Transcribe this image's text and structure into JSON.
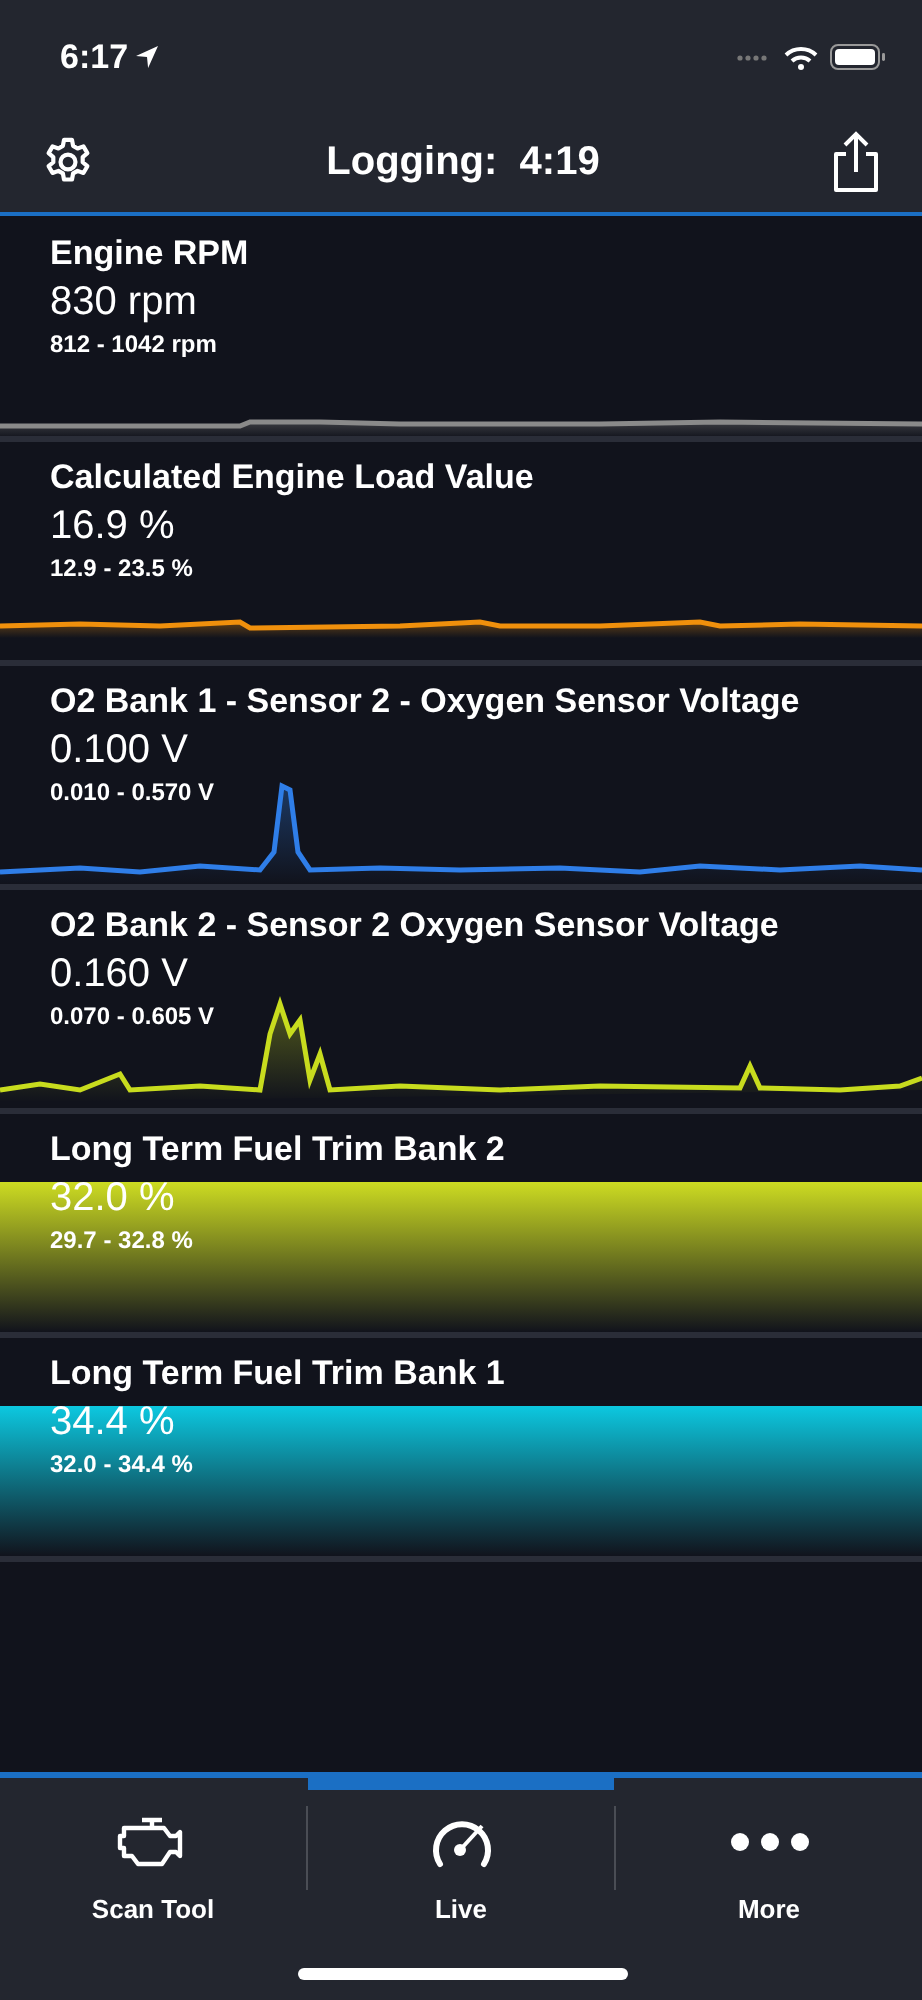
{
  "status_bar": {
    "time": "6:17"
  },
  "header": {
    "title": "Logging:  4:19"
  },
  "gauges": [
    {
      "kind": "line",
      "name": "Engine RPM",
      "value": "830 rpm",
      "range": "812 - 1042 rpm",
      "color": "#8a8a8a"
    },
    {
      "kind": "line",
      "name": "Calculated Engine Load Value",
      "value": "16.9 %",
      "range": "12.9 - 23.5 %",
      "color": "#f0900c"
    },
    {
      "kind": "line",
      "name": "O2 Bank 1 - Sensor 2 - Oxygen Sensor Voltage",
      "value": "0.100 V",
      "range": "0.010 - 0.570 V",
      "color": "#2f7ee8"
    },
    {
      "kind": "line",
      "name": "O2 Bank 2 - Sensor 2 Oxygen Sensor Voltage",
      "value": "0.160 V",
      "range": "0.070 - 0.605 V",
      "color": "#c8dc1e"
    },
    {
      "kind": "fill",
      "name": "Long Term Fuel Trim Bank 2",
      "value": "32.0 %",
      "range": "29.7 - 32.8 %",
      "color": "#cddc22"
    },
    {
      "kind": "fill",
      "name": "Long Term Fuel Trim Bank 1",
      "value": "34.4 %",
      "range": "32.0 - 34.4 %",
      "color": "#0cc8e0"
    }
  ],
  "tabs": [
    {
      "label": "Scan Tool",
      "selected": false
    },
    {
      "label": "Live",
      "selected": true
    },
    {
      "label": "More",
      "selected": false
    }
  ]
}
